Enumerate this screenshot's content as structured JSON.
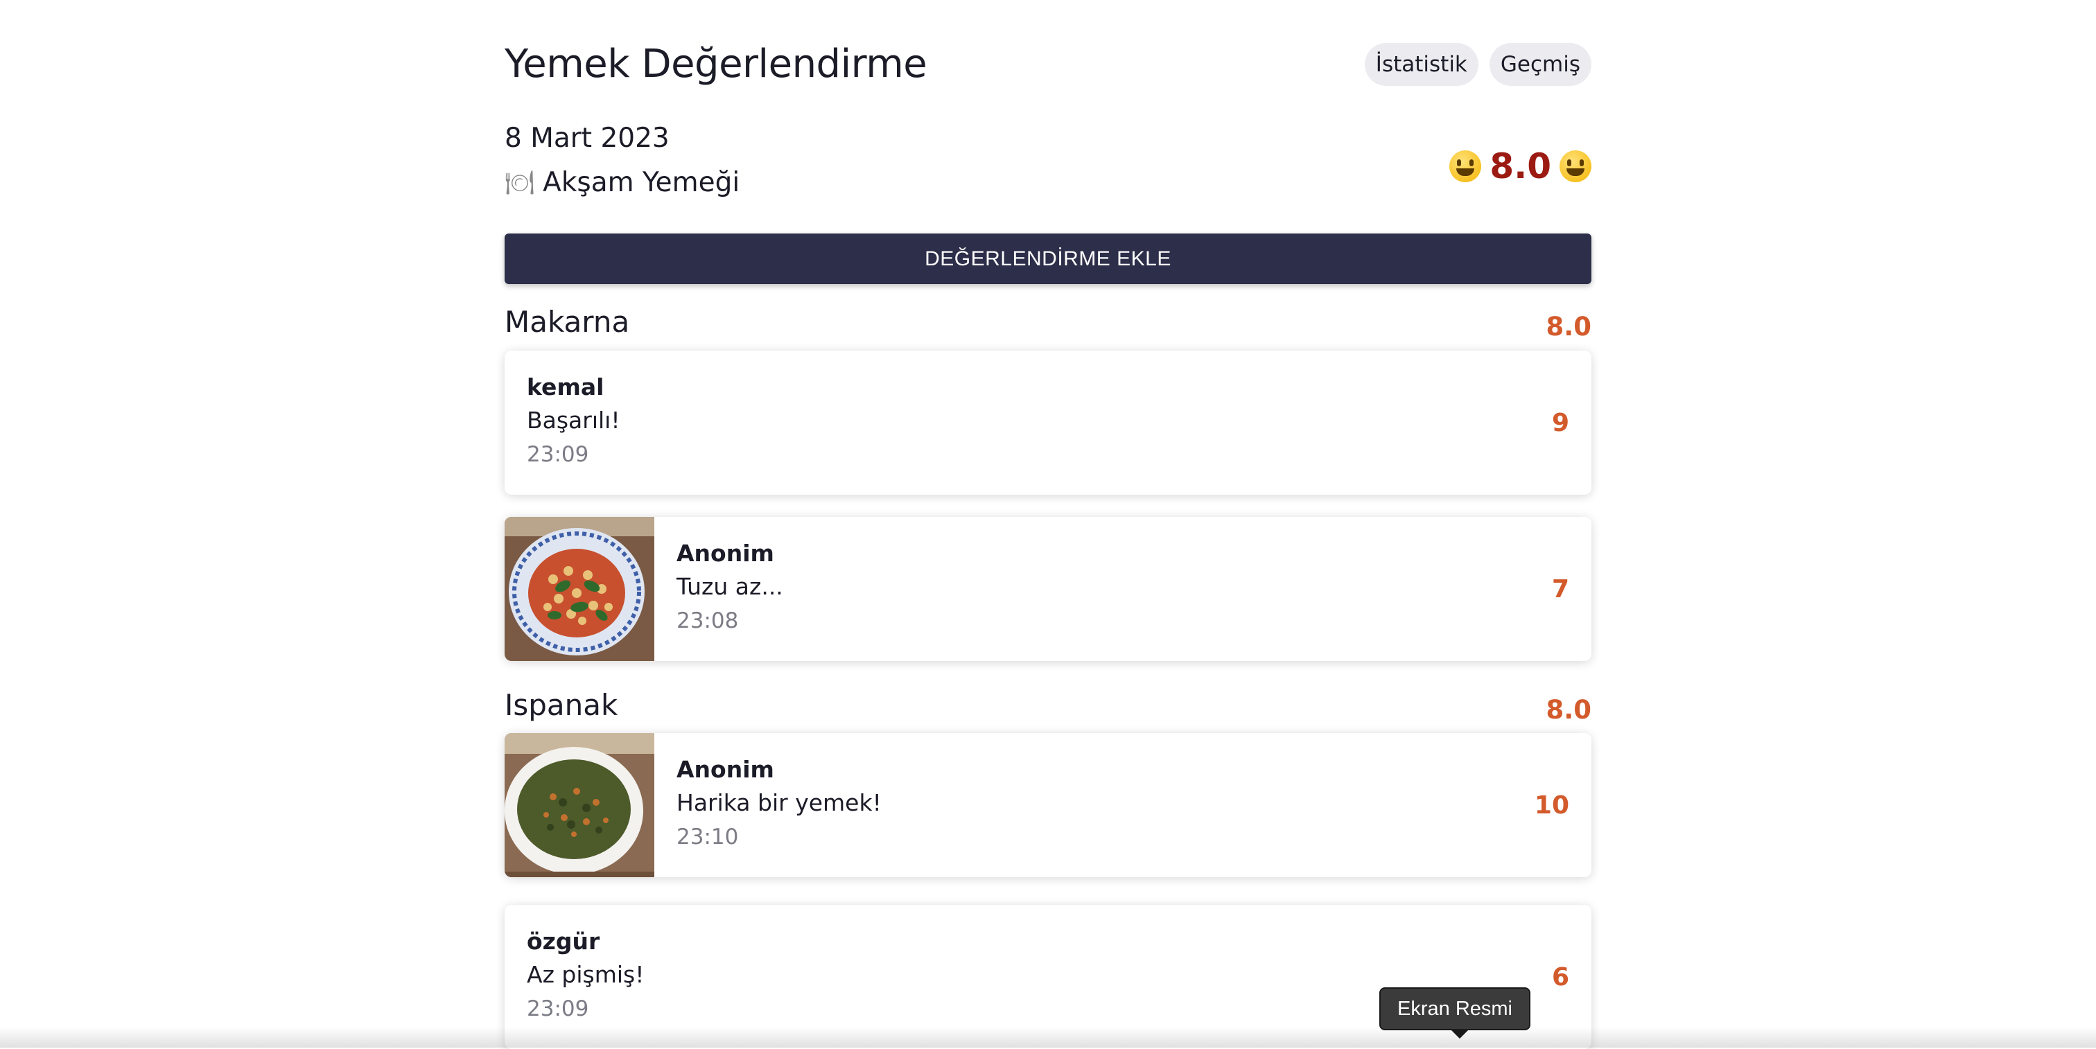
{
  "header": {
    "title": "Yemek Değerlendirme",
    "nav": [
      "İstatistik",
      "Geçmiş"
    ]
  },
  "meal": {
    "date": "8 Mart 2023",
    "icon": "fork-knife-plate-icon",
    "name": "Akşam Yemeği",
    "score": "8.0",
    "emoji": "grinning-face-icon"
  },
  "actions": {
    "add_rating": "DEĞERLENDİRME EKLE"
  },
  "sections": [
    {
      "name": "Makarna",
      "score": "8.0",
      "reviews": [
        {
          "user": "kemal",
          "comment": "Başarılı!",
          "time": "23:09",
          "score": "9",
          "photo": false
        },
        {
          "user": "Anonim",
          "comment": "Tuzu az...",
          "time": "23:08",
          "score": "7",
          "photo": true
        }
      ]
    },
    {
      "name": "Ispanak",
      "score": "8.0",
      "reviews": [
        {
          "user": "Anonim",
          "comment": "Harika bir yemek!",
          "time": "23:10",
          "score": "10",
          "photo": true
        },
        {
          "user": "özgür",
          "comment": "Az pişmiş!",
          "time": "23:09",
          "score": "6",
          "photo": false
        }
      ]
    }
  ],
  "tooltip": {
    "label": "Ekran Resmi"
  },
  "colors": {
    "accent_button": "#2d2e49",
    "score_orange": "#d35a2b",
    "overall_score_red": "#9b1b12",
    "pill_background": "#ececf0"
  }
}
